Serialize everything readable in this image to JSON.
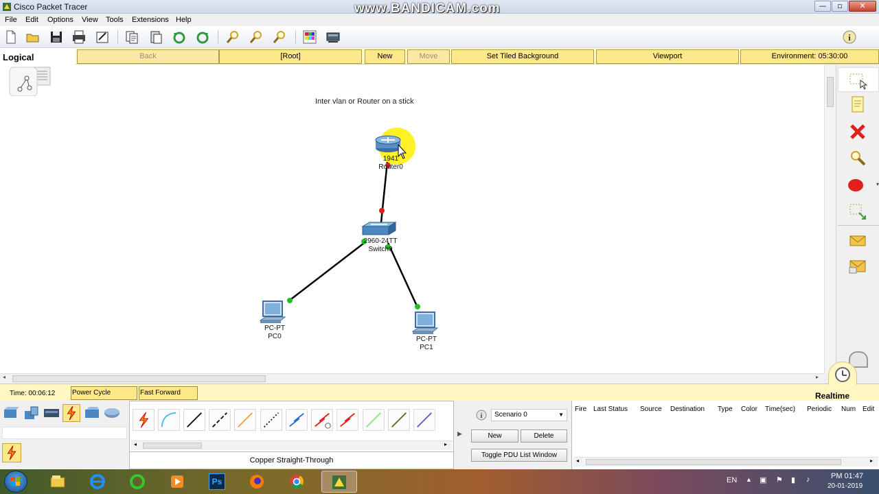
{
  "window": {
    "title": "Cisco Packet Tracer",
    "watermark": "www.BANDICAM.com",
    "controls": {
      "minimize": "—",
      "maximize": "▫",
      "close": "✕"
    }
  },
  "menu": [
    "File",
    "Edit",
    "Options",
    "View",
    "Tools",
    "Extensions",
    "Help"
  ],
  "toolbar": {
    "icons": [
      "new-icon",
      "open-icon",
      "save-icon",
      "print-icon",
      "activity-wizard-icon",
      "copy-icon",
      "paste-icon",
      "undo-icon",
      "redo-icon",
      "zoom-in-icon",
      "zoom-reset-icon",
      "zoom-out-icon",
      "palette-icon",
      "custom-device-icon"
    ],
    "help_icon": "info-icon"
  },
  "workspace_bar": {
    "mode": "Logical",
    "back": "Back",
    "root": "[Root]",
    "new_cluster": "New Cluster",
    "move_object": "Move Object",
    "set_tiled_background": "Set Tiled Background",
    "viewport": "Viewport",
    "environment": "Environment: 05:30:00"
  },
  "canvas": {
    "title": "Inter vlan or Router on a stick",
    "devices": {
      "router": {
        "model": "1941",
        "name": "Router0"
      },
      "switch": {
        "model": "2960-24TT",
        "name": "Switch0"
      },
      "pc0": {
        "model": "PC-PT",
        "name": "PC0"
      },
      "pc1": {
        "model": "PC-PT",
        "name": "PC1"
      }
    },
    "link_colors": {
      "down": "#e0201a",
      "up": "#22c026",
      "highlight": "#ffee00"
    }
  },
  "right_palette": [
    "select-icon",
    "note-icon",
    "delete-icon",
    "inspect-icon",
    "draw-ellipse-icon",
    "resize-icon",
    "add-simple-pdu-icon",
    "add-complex-pdu-icon"
  ],
  "timebar": {
    "time": "Time: 00:06:12",
    "power_cycle": "Power Cycle Devices",
    "fast_forward": "Fast Forward Time",
    "mode": "Realtime"
  },
  "device_categories": [
    "routers-icon",
    "switches-icon",
    "hubs-icon",
    "connections-icon",
    "wireless-icon",
    "wan-emulation-icon"
  ],
  "connections": {
    "types": [
      "automatic-connection-icon",
      "console-cable-icon",
      "copper-straight-icon",
      "copper-cross-icon",
      "fiber-icon",
      "phone-cable-icon",
      "coaxial-icon",
      "serial-dce-icon",
      "serial-dte-icon",
      "octal-icon",
      "iot-custom-icon",
      "usb-icon"
    ],
    "selected_name": "Copper Straight-Through"
  },
  "scenario": {
    "selected": "Scenario 0",
    "new": "New",
    "delete": "Delete",
    "toggle": "Toggle PDU List Window"
  },
  "pdu_columns": [
    "Fire",
    "Last Status",
    "Source",
    "Destination",
    "Type",
    "Color",
    "Time(sec)",
    "Periodic",
    "Num",
    "Edit"
  ],
  "taskbar": {
    "apps": [
      "file-explorer-icon",
      "internet-explorer-icon",
      "green-ring-icon",
      "media-player-icon",
      "photoshop-icon",
      "firefox-icon",
      "chrome-icon",
      "packet-tracer-icon"
    ],
    "photoshop_label": "Ps",
    "language": "EN",
    "time": "PM 01:47",
    "date": "20-01-2019"
  }
}
